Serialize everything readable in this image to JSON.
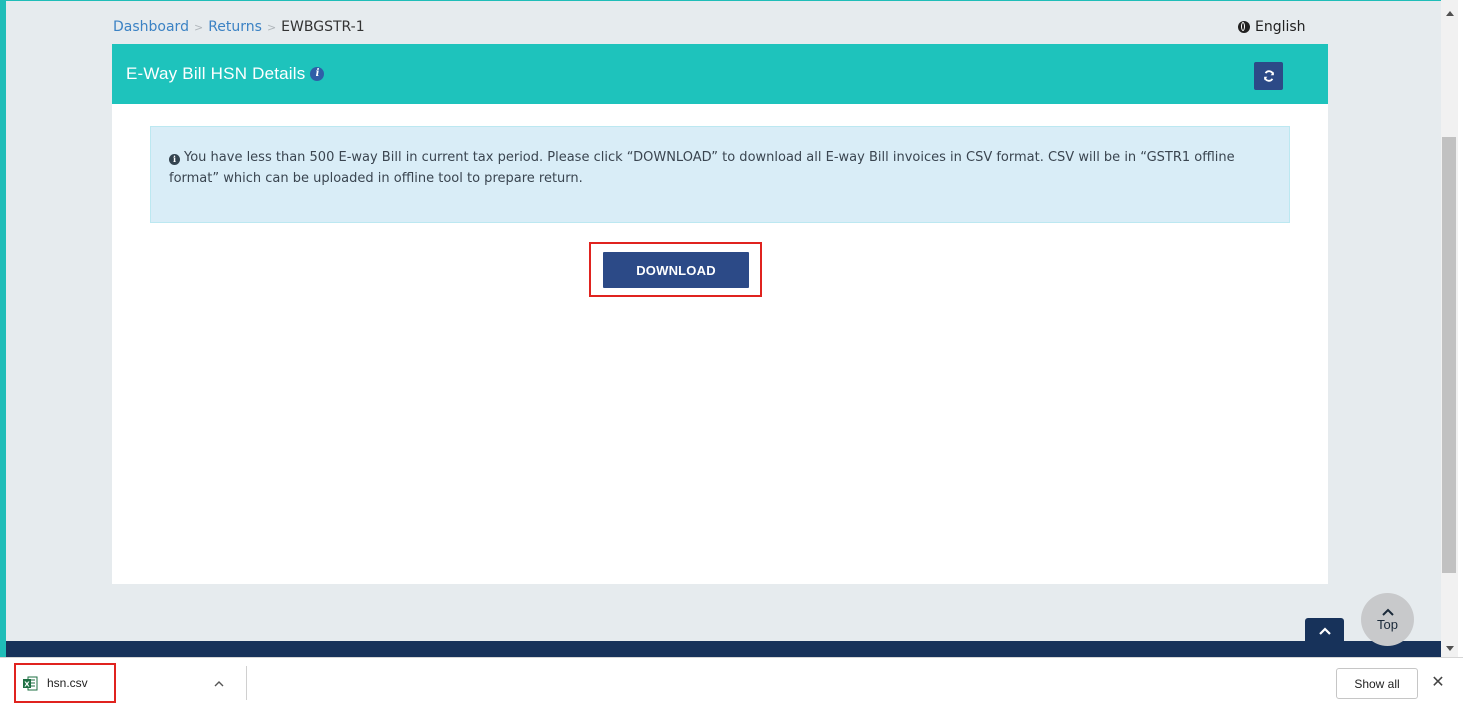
{
  "breadcrumb": {
    "items": [
      {
        "label": "Dashboard"
      },
      {
        "label": "Returns"
      },
      {
        "label": "EWBGSTR-1"
      }
    ]
  },
  "language": {
    "label": "English",
    "icon": "globe-icon"
  },
  "panel": {
    "title": "E-Way Bill HSN Details",
    "title_icon": "info-icon",
    "refresh_icon": "refresh-icon",
    "colors": {
      "header": "#1ec3bc",
      "button": "#2c4a87"
    }
  },
  "alert": {
    "icon": "info-icon",
    "text": "You have less than 500 E-way Bill in current tax period. Please click “DOWNLOAD” to download all E-way Bill invoices in CSV format. CSV will be in “GSTR1 offline format” which can be uploaded in offline tool to prepare return."
  },
  "download_button": {
    "label": "DOWNLOAD"
  },
  "scroll_top": {
    "small_icon": "chevron-up-icon",
    "circle_label": "Top"
  },
  "download_shelf": {
    "file_name": "hsn.csv",
    "file_icon": "excel-icon",
    "show_all_label": "Show all",
    "close_label": "✕"
  }
}
